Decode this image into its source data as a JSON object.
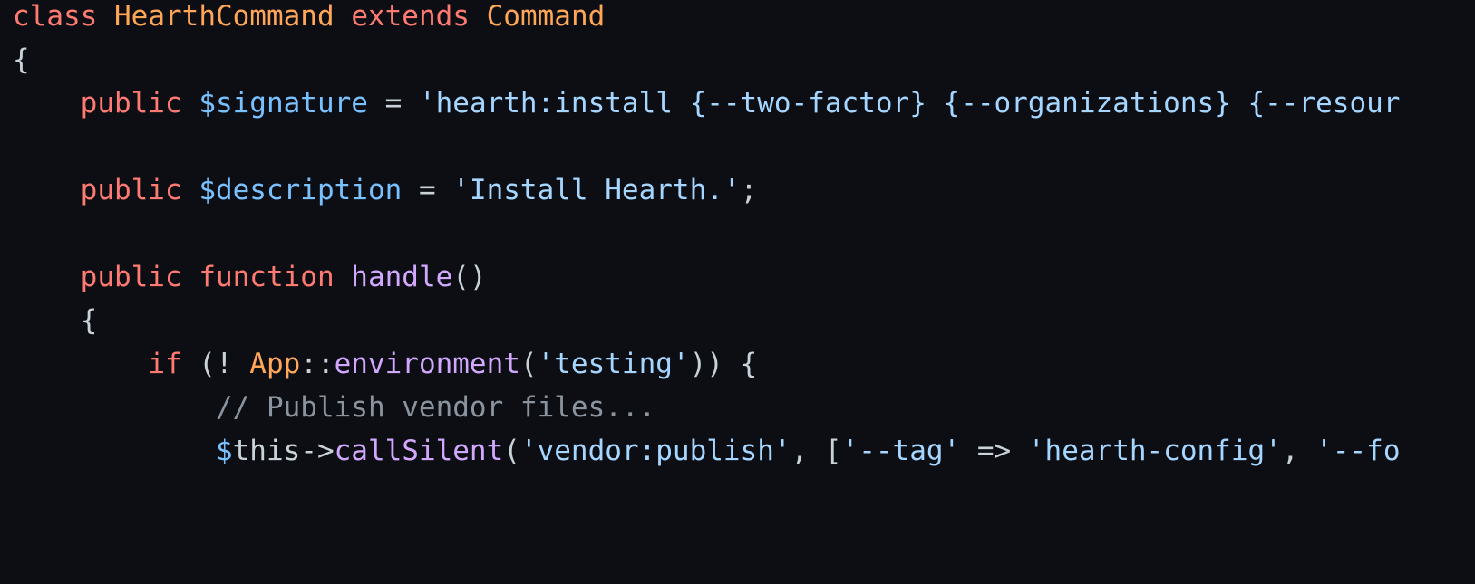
{
  "colors": {
    "background": "#0c0e14",
    "keyword": "#ff7b72",
    "class_name": "#ffa657",
    "variable": "#79c0ff",
    "string": "#a5d6ff",
    "function": "#d2a8ff",
    "comment": "#8b949e",
    "punctuation": "#c9d1d9"
  },
  "lines": [
    [
      {
        "type": "kw",
        "text": "class"
      },
      {
        "type": "punc",
        "text": " "
      },
      {
        "type": "cls",
        "text": "HearthCommand"
      },
      {
        "type": "punc",
        "text": " "
      },
      {
        "type": "kw",
        "text": "extends"
      },
      {
        "type": "punc",
        "text": " "
      },
      {
        "type": "cls",
        "text": "Command"
      }
    ],
    [
      {
        "type": "punc",
        "text": "{"
      }
    ],
    [
      {
        "type": "punc",
        "text": "    "
      },
      {
        "type": "kw",
        "text": "public"
      },
      {
        "type": "punc",
        "text": " "
      },
      {
        "type": "var",
        "text": "$signature"
      },
      {
        "type": "punc",
        "text": " = "
      },
      {
        "type": "str",
        "text": "'hearth:install {--two-factor} {--organizations} {--resour"
      }
    ],
    [],
    [
      {
        "type": "punc",
        "text": "    "
      },
      {
        "type": "kw",
        "text": "public"
      },
      {
        "type": "punc",
        "text": " "
      },
      {
        "type": "var",
        "text": "$description"
      },
      {
        "type": "punc",
        "text": " = "
      },
      {
        "type": "str",
        "text": "'Install Hearth.'"
      },
      {
        "type": "punc",
        "text": ";"
      }
    ],
    [],
    [
      {
        "type": "punc",
        "text": "    "
      },
      {
        "type": "kw",
        "text": "public"
      },
      {
        "type": "punc",
        "text": " "
      },
      {
        "type": "kw",
        "text": "function"
      },
      {
        "type": "punc",
        "text": " "
      },
      {
        "type": "fn",
        "text": "handle"
      },
      {
        "type": "punc",
        "text": "()"
      }
    ],
    [
      {
        "type": "punc",
        "text": "    {"
      }
    ],
    [
      {
        "type": "punc",
        "text": "        "
      },
      {
        "type": "kw",
        "text": "if"
      },
      {
        "type": "punc",
        "text": " (! "
      },
      {
        "type": "cls",
        "text": "App"
      },
      {
        "type": "punc",
        "text": "::"
      },
      {
        "type": "fn",
        "text": "environment"
      },
      {
        "type": "punc",
        "text": "("
      },
      {
        "type": "str",
        "text": "'testing'"
      },
      {
        "type": "punc",
        "text": ")) {"
      }
    ],
    [
      {
        "type": "punc",
        "text": "            "
      },
      {
        "type": "com",
        "text": "// Publish vendor files..."
      }
    ],
    [
      {
        "type": "punc",
        "text": "            "
      },
      {
        "type": "var",
        "text": "$"
      },
      {
        "type": "punc",
        "text": "this->"
      },
      {
        "type": "fn",
        "text": "callSilent"
      },
      {
        "type": "punc",
        "text": "("
      },
      {
        "type": "str",
        "text": "'vendor:publish'"
      },
      {
        "type": "punc",
        "text": ", ["
      },
      {
        "type": "str",
        "text": "'--tag'"
      },
      {
        "type": "punc",
        "text": " => "
      },
      {
        "type": "str",
        "text": "'hearth-config'"
      },
      {
        "type": "punc",
        "text": ", "
      },
      {
        "type": "str",
        "text": "'--fo"
      }
    ]
  ]
}
